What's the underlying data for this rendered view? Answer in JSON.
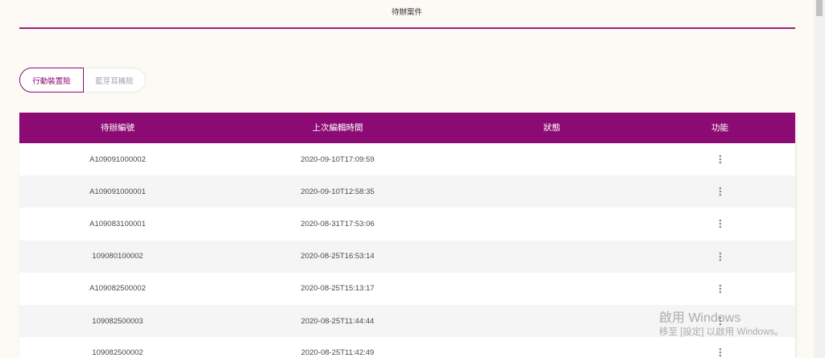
{
  "page": {
    "title": "待辦案件"
  },
  "tabs": [
    {
      "label": "行動裝置險",
      "active": true
    },
    {
      "label": "藍芽耳機險",
      "active": false
    }
  ],
  "table": {
    "columns": [
      "待辦編號",
      "上次編輯時間",
      "狀態",
      "功能"
    ],
    "rows": [
      {
        "case_number": "A109091000002",
        "last_edited": "2020-09-10T17:09:59"
      },
      {
        "case_number": "A109091000001",
        "last_edited": "2020-09-10T12:58:35"
      },
      {
        "case_number": "A109083100001",
        "last_edited": "2020-08-31T17:53:06"
      },
      {
        "case_number": "109080100002",
        "last_edited": "2020-08-25T16:53:14"
      },
      {
        "case_number": "A109082500002",
        "last_edited": "2020-08-25T15:13:17"
      },
      {
        "case_number": "109082500003",
        "last_edited": "2020-08-25T11:44:44"
      },
      {
        "case_number": "109082500002",
        "last_edited": "2020-08-25T11:42:49"
      }
    ],
    "row_action_icon": "more-vert-icon"
  },
  "colors": {
    "accent": "#8c0a73",
    "page_background": "#fdfaf6",
    "row_stripe": "#f5f5f5"
  },
  "os_watermark": {
    "title": "啟用 Windows",
    "subtitle": "移至 [設定] 以啟用 Windows。"
  }
}
